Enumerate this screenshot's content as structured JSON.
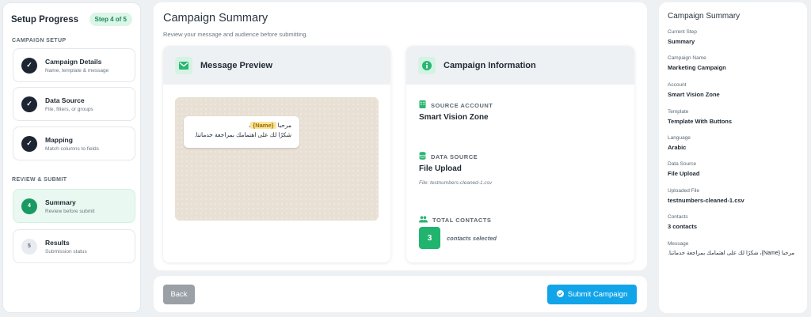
{
  "sidebar": {
    "title": "Setup Progress",
    "step_badge": "Step 4 of 5",
    "section_setup": "CAMPAIGN SETUP",
    "section_review": "REVIEW & SUBMIT",
    "steps": [
      {
        "name": "Campaign Details",
        "sub": "Name, template & message",
        "status": "done",
        "marker": "✓"
      },
      {
        "name": "Data Source",
        "sub": "File, filters, or groups",
        "status": "done",
        "marker": "✓"
      },
      {
        "name": "Mapping",
        "sub": "Match columns to fields",
        "status": "done",
        "marker": "✓"
      },
      {
        "name": "Summary",
        "sub": "Review before submit",
        "status": "current",
        "marker": "4"
      },
      {
        "name": "Results",
        "sub": "Submission status",
        "status": "pending",
        "marker": "5"
      }
    ]
  },
  "main": {
    "title": "Campaign Summary",
    "subtitle": "Review your message and audience before submitting.",
    "preview": {
      "title": "Message Preview",
      "greeting": "مرحبا",
      "name_tag": "{Name}",
      "comma": "،",
      "body": "شكرًا لك على اهتمامك بمراجعة خدماتنا."
    },
    "info": {
      "title": "Campaign Information",
      "source_label": "SOURCE ACCOUNT",
      "source_value": "Smart Vision Zone",
      "data_label": "DATA SOURCE",
      "data_value": "File Upload",
      "file_note": "File: testnumbers-cleaned-1.csv",
      "contacts_label": "TOTAL CONTACTS",
      "contacts_count": "3",
      "contacts_text": "contacts selected"
    }
  },
  "actions": {
    "back": "Back",
    "submit": "Submit Campaign"
  },
  "summary": {
    "title": "Campaign Summary",
    "items": [
      {
        "label": "Current Step",
        "value": "Summary"
      },
      {
        "label": "Campaign Name",
        "value": "Marketing Campaign"
      },
      {
        "label": "Account",
        "value": "Smart Vision Zone"
      },
      {
        "label": "Template",
        "value": "Template With Buttons"
      },
      {
        "label": "Language",
        "value": "Arabic"
      },
      {
        "label": "Data Source",
        "value": "File Upload"
      },
      {
        "label": "Uploaded File",
        "value": "testnumbers-cleaned-1.csv"
      },
      {
        "label": "Contacts",
        "value": "3 contacts"
      }
    ],
    "message_label": "Message",
    "message_value": "مرحبا {Name}، شكرًا لك على اهتمامك بمراجعة خدماتنا."
  },
  "colors": {
    "accent_green": "#1a9a63",
    "submit_blue": "#12a4e8",
    "back_gray": "#9aa0a6"
  }
}
